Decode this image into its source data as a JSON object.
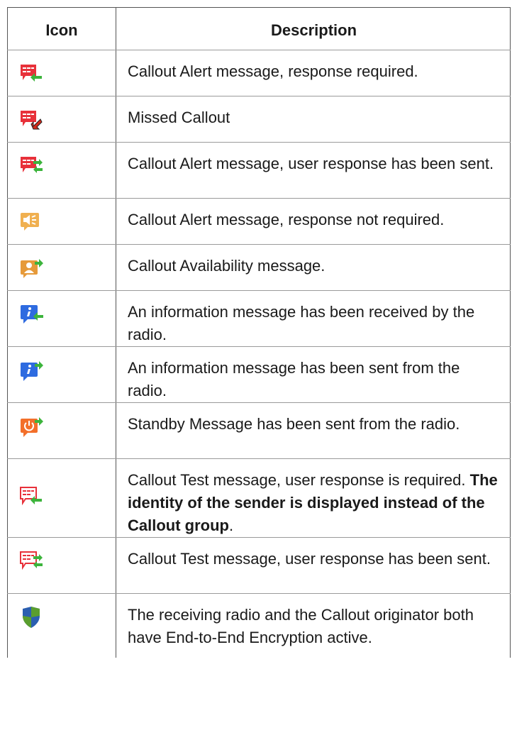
{
  "table": {
    "headers": {
      "icon": "Icon",
      "description": "Description"
    },
    "rows": [
      {
        "icon": "callout-alert-response-required-icon",
        "description": "Callout Alert message, response required."
      },
      {
        "icon": "missed-callout-icon",
        "description": "Missed Callout"
      },
      {
        "icon": "callout-alert-response-sent-icon",
        "description": "Callout Alert message, user response has been sent."
      },
      {
        "icon": "callout-alert-no-response-icon",
        "description": "Callout Alert message, response not required."
      },
      {
        "icon": "callout-availability-icon",
        "description": "Callout Availability message."
      },
      {
        "icon": "info-received-icon",
        "description": "An information message has been received by the radio."
      },
      {
        "icon": "info-sent-icon",
        "description": "An information message has been sent from the radio."
      },
      {
        "icon": "standby-sent-icon",
        "description": "Standby Message has been sent from the radio."
      },
      {
        "icon": "callout-test-response-required-icon",
        "description": "Callout Test message, user response is required.",
        "description_bold": "The identity of the sender is displayed instead of the Callout group",
        "description_tail": "."
      },
      {
        "icon": "callout-test-response-sent-icon",
        "description": "Callout Test message, user response has been sent."
      },
      {
        "icon": "encryption-shield-icon",
        "description": "The receiving radio and the Callout originator both have End-to-End Encryption active."
      }
    ]
  },
  "colors": {
    "alert_red": "#e8313a",
    "arrow_green": "#3cb43c",
    "orange_light": "#f0b050",
    "orange_person": "#e69a3a",
    "info_blue": "#2e6be0",
    "standby_orange": "#f36f2a",
    "shield_blue": "#2b5fb0",
    "shield_green": "#5a9e2e"
  }
}
